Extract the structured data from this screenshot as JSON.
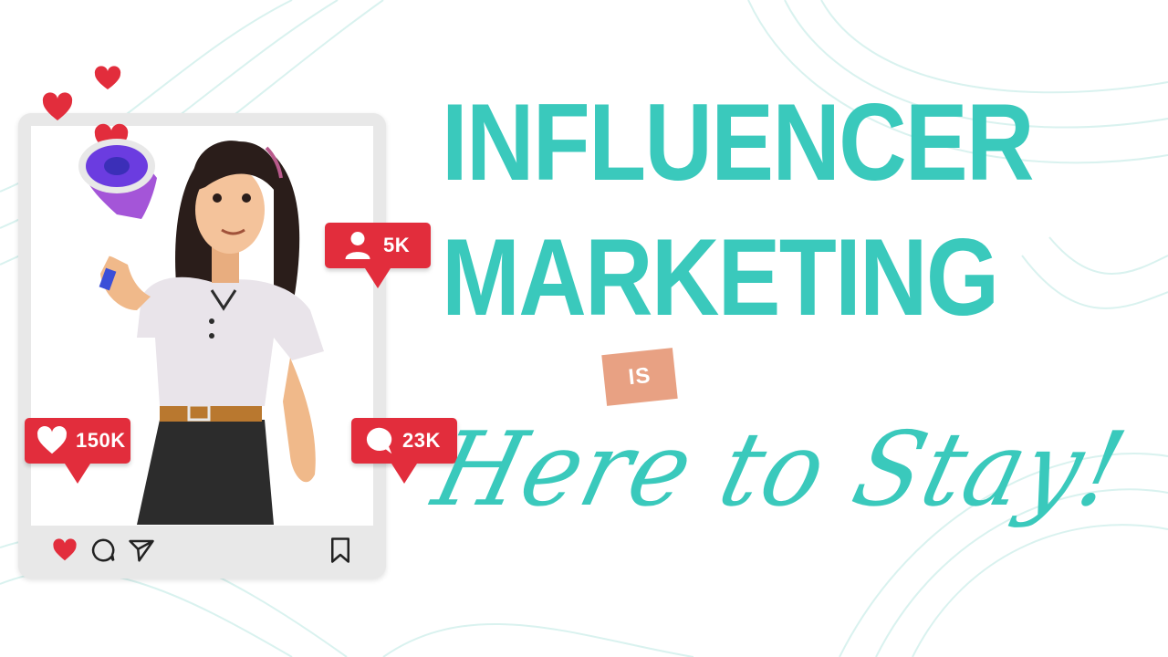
{
  "headline": {
    "line1": "INFLUENCER",
    "line2": "MARKETING",
    "connector": "IS",
    "tagline": "Here to Stay!"
  },
  "notifications": {
    "followers": {
      "icon": "user-icon",
      "value": "5K"
    },
    "likes": {
      "icon": "heart-icon",
      "value": "150K"
    },
    "comments": {
      "icon": "comment-icon",
      "value": "23K"
    }
  },
  "post_actions": [
    "heart-icon",
    "comment-icon",
    "send-icon",
    "bookmark-icon"
  ],
  "colors": {
    "accent": "#3ac9bc",
    "badge": "#e8a183",
    "notification": "#e22d3c",
    "frame": "#e8e8e8"
  }
}
